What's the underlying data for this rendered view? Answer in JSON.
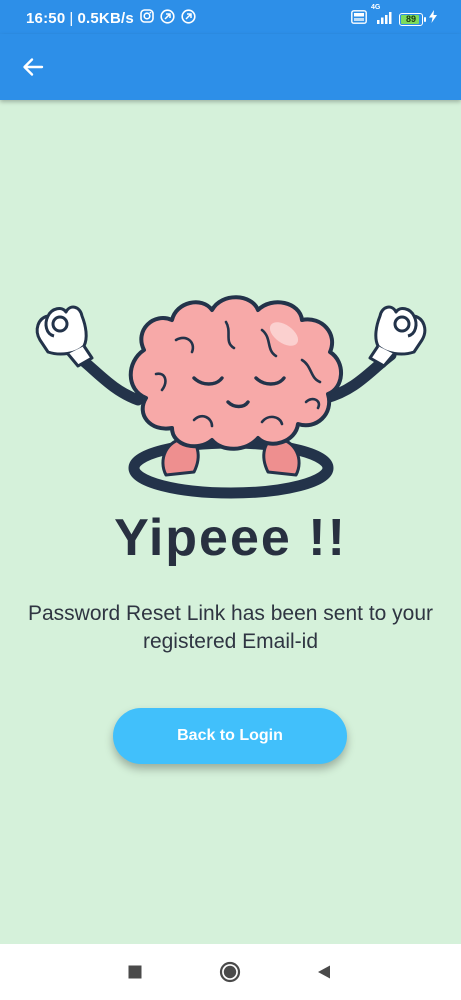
{
  "status_bar": {
    "time": "16:50",
    "separator": "|",
    "net_speed": "0.5KB/s",
    "network_type": "4G",
    "battery_level": 89,
    "battery_text": "89",
    "icons": [
      "instagram-icon",
      "notification-icon",
      "notification-icon",
      "volte-icon",
      "signal-icon",
      "battery-icon",
      "charging-icon"
    ]
  },
  "app_bar": {
    "back_icon": "arrow-left-icon",
    "background_color": "#2d8fe8"
  },
  "content": {
    "illustration": "meditating-brain-illustration",
    "headline": "Yipeee !!",
    "message": "Password Reset Link has been sent to your registered Email-id",
    "button_label": "Back to Login",
    "background_color": "#d5f1da",
    "button_color": "#41c0fb",
    "text_color": "#283040"
  },
  "nav_bar": {
    "recents_icon": "square-icon",
    "home_icon": "circle-icon",
    "back_icon": "triangle-back-icon"
  }
}
